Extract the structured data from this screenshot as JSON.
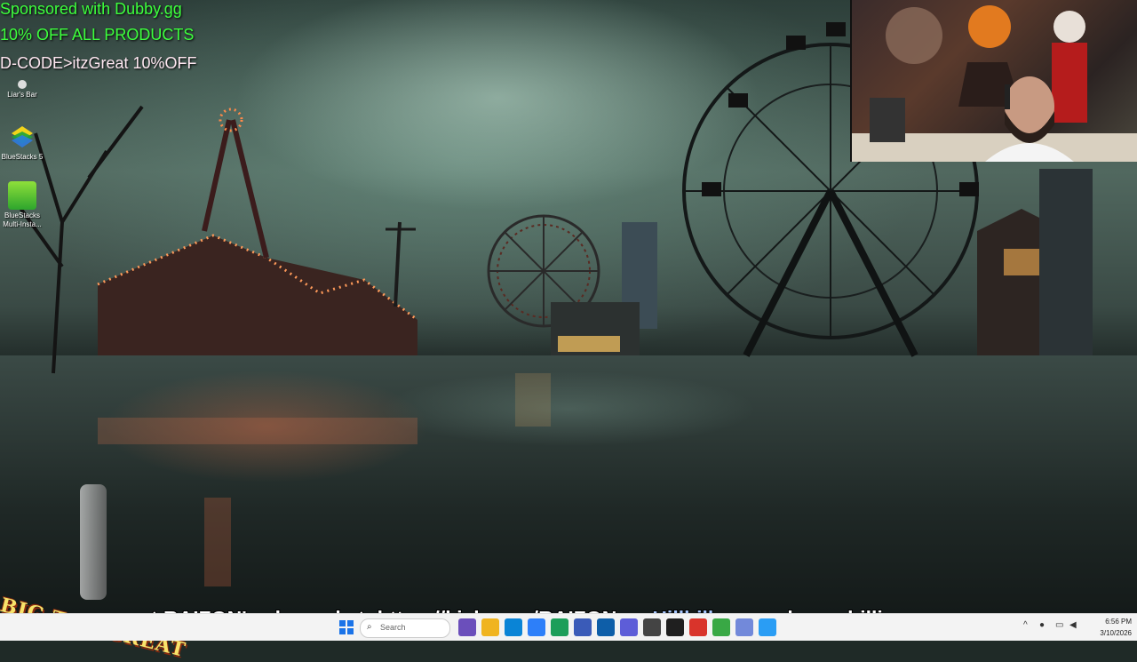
{
  "sponsor": {
    "line1": "Sponsored with Dubby.gg",
    "line2": "10% OFF ALL PRODUCTS",
    "line3": "D-CODE>itzGreat 10%OFF"
  },
  "desktop_icons": [
    {
      "label": "Liar's Bar",
      "icon": "liars-bar-icon"
    },
    {
      "label": "BlueStacks 5",
      "icon": "bluestacks-icon"
    },
    {
      "label": "BlueStacks Multi-Insta...",
      "icon": "bluestacks-multi-instance-icon"
    }
  ],
  "logo": {
    "text": "BIG TOP GREAT"
  },
  "ticker": {
    "lead": "t RAIZON's channel at: https://kick.com/RAIZON",
    "user": "Hillbillys",
    "message": " : we here chillin"
  },
  "taskbar": {
    "search_placeholder": "Search",
    "apps": [
      "start",
      "search",
      "edge",
      "file-explorer",
      "store",
      "mail",
      "vpn",
      "browser",
      "game",
      "chat",
      "obs",
      "steam",
      "chrome",
      "discord",
      "settings"
    ]
  },
  "tray": {
    "time": "6:56 PM",
    "date": "3/10/2026"
  },
  "colors": {
    "sponsor_green": "#3dff3d",
    "ticker_user": "#a8c8ff",
    "taskbar_bg": "#f3f3f3"
  }
}
